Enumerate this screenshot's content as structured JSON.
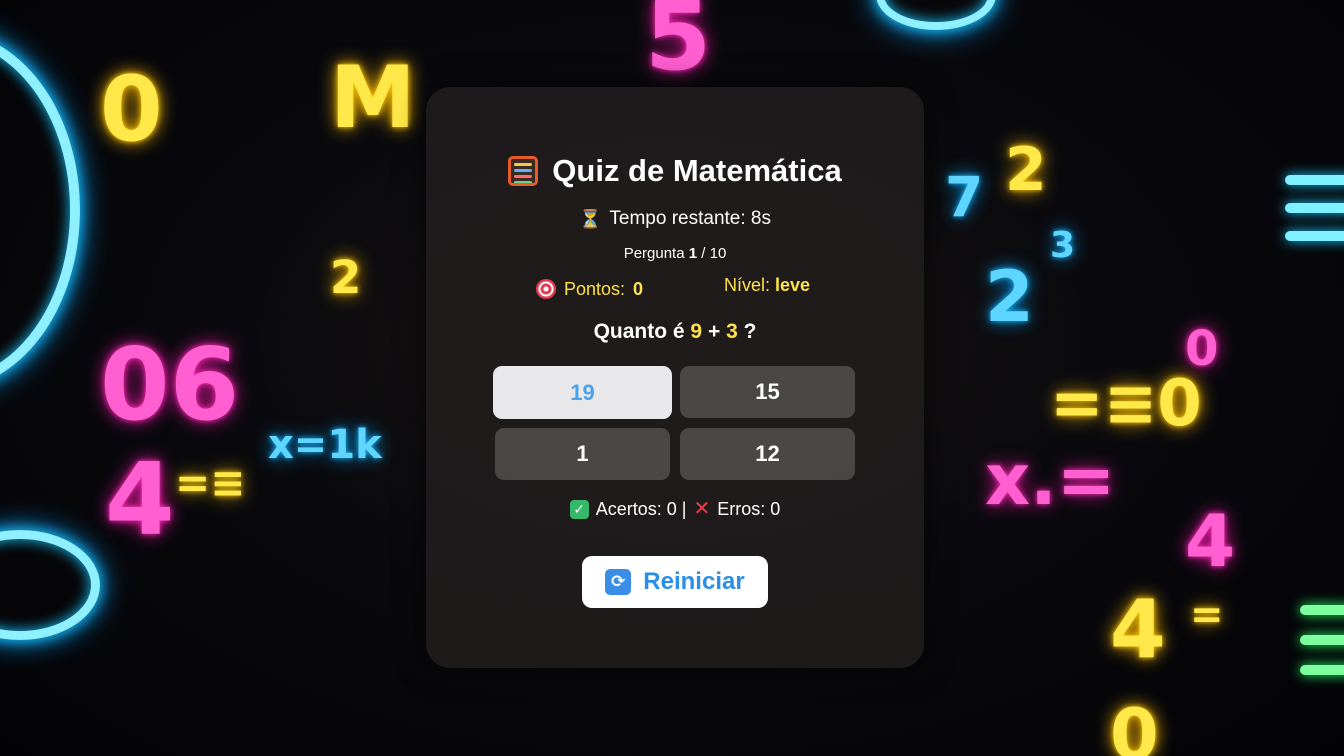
{
  "app": {
    "title": "Quiz de Matemática",
    "abacus_icon": "abacus-icon"
  },
  "timer": {
    "icon": "hourglass-icon",
    "text": "Tempo restante: 8s"
  },
  "progress": {
    "prefix": "Pergunta",
    "current": "1",
    "separator": "/",
    "total": "10"
  },
  "points": {
    "icon": "target-icon",
    "label": "Pontos:",
    "value": "0"
  },
  "level": {
    "label": "Nível:",
    "value": "leve"
  },
  "question": {
    "prefix": "Quanto é",
    "a": "9",
    "operator": "+",
    "b": "3",
    "suffix": "?"
  },
  "answers": [
    {
      "label": "19",
      "selected": true
    },
    {
      "label": "15",
      "selected": false
    },
    {
      "label": "1",
      "selected": false
    },
    {
      "label": "12",
      "selected": false
    }
  ],
  "score": {
    "hits_icon": "check-icon",
    "hits_text": "Acertos: 0 |",
    "errors_icon": "cross-icon",
    "errors_text": "Erros: 0"
  },
  "restart": {
    "icon": "refresh-icon",
    "label": "Reiniciar"
  },
  "background": {
    "glyphs": [
      "0",
      "M",
      "5",
      "2",
      "7",
      "2",
      "3",
      "2",
      "0",
      "06",
      "x=1k",
      "4",
      "=≡",
      "=≡0",
      "x.=",
      "4",
      "4",
      "=",
      "0"
    ]
  },
  "colors": {
    "accent_yellow": "#ffe14a",
    "button_blue": "#2a8fe6",
    "card_bg": "#201c1c"
  }
}
